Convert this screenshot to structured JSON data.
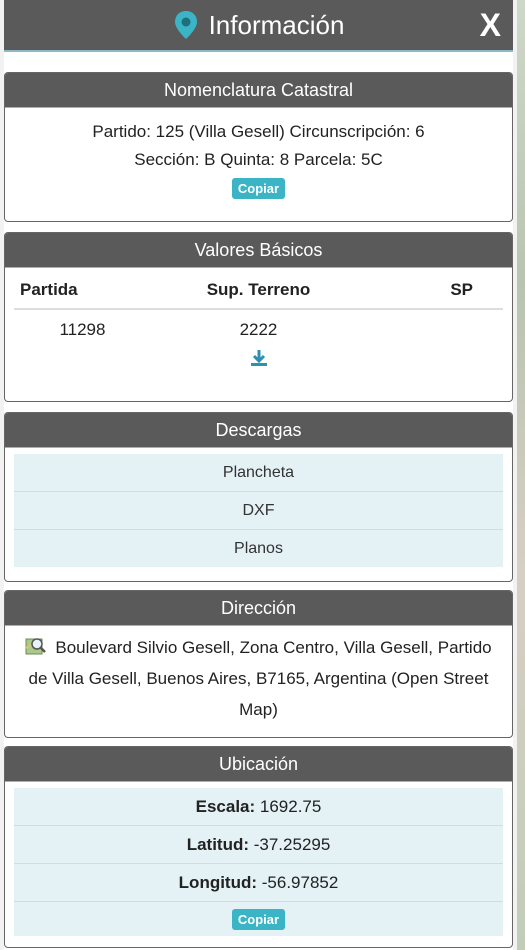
{
  "header": {
    "title": "Información",
    "close": "X",
    "pin_icon": "map-pin-icon",
    "accent": "#3bb4c6"
  },
  "nomenclatura": {
    "title": "Nomenclatura Catastral",
    "line1": "Partido: 125 (Villa Gesell) Circunscripción: 6",
    "line2": "Sección: B Quinta: 8 Parcela: 5C",
    "copy_label": "Copiar"
  },
  "valores": {
    "title": "Valores Básicos",
    "columns": [
      "Partida",
      "Sup. Terreno",
      "SP"
    ],
    "rows": [
      [
        "11298",
        "2222",
        ""
      ]
    ],
    "download_icon": "download-icon"
  },
  "descargas": {
    "title": "Descargas",
    "items": [
      "Plancheta",
      "DXF",
      "Planos"
    ]
  },
  "direccion": {
    "title": "Dirección",
    "icon": "map-search-icon",
    "address": "Boulevard Silvio Gesell, Zona Centro, Villa Gesell, Partido de Villa Gesell, Buenos Aires, B7165, Argentina (Open Street Map)"
  },
  "ubicacion": {
    "title": "Ubicación",
    "escala_label": "Escala:",
    "escala_value": " 1692.75",
    "latitud_label": "Latitud:",
    "latitud_value": " -37.25295",
    "longitud_label": "Longitud:",
    "longitud_value": " -56.97852",
    "copy_label": "Copiar"
  }
}
